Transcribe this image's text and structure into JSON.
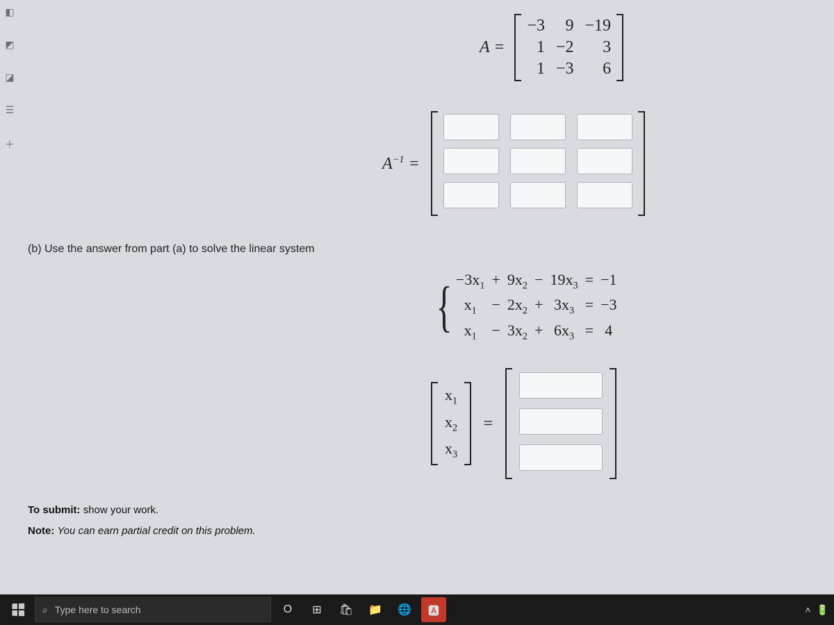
{
  "left_tools": {
    "t1": "◧",
    "t2": "◩",
    "t3": "◪",
    "t4": "☰",
    "t5": "＋"
  },
  "matrixA": {
    "label": "A =",
    "rows": [
      [
        "−3",
        "9",
        "−19"
      ],
      [
        "1",
        "−2",
        "3"
      ],
      [
        "1",
        "−3",
        "6"
      ]
    ]
  },
  "AinvLabel": "A",
  "AinvSup": "−1",
  "AinvEquals": " =",
  "partB": "(b) Use the answer from part (a) to solve the linear system",
  "system": {
    "rows": [
      {
        "c1": "−3x",
        "s1": "1",
        "op1": "+",
        "c2": "9x",
        "s2": "2",
        "op2": "−",
        "c3": "19x",
        "s3": "3",
        "eq": "=",
        "rhs": "−1"
      },
      {
        "c1": "x",
        "s1": "1",
        "op1": "−",
        "c2": "2x",
        "s2": "2",
        "op2": "+",
        "c3": "3x",
        "s3": "3",
        "eq": "=",
        "rhs": "−3"
      },
      {
        "c1": "x",
        "s1": "1",
        "op1": "−",
        "c2": "3x",
        "s2": "2",
        "op2": "+",
        "c3": "6x",
        "s3": "3",
        "eq": "=",
        "rhs": "4"
      }
    ]
  },
  "xvec": {
    "x": "x",
    "subs": [
      "1",
      "2",
      "3"
    ],
    "eq": "="
  },
  "notes": {
    "l1a": "To submit: ",
    "l1b": "show your work.",
    "l2a": "Note: ",
    "l2b": "You can earn partial credit on this problem."
  },
  "taskbar": {
    "search_placeholder": "Type here to search",
    "cortana": "O",
    "taskview": "⊞",
    "store": "🛍",
    "files": "📁",
    "edge": "🌐",
    "app": "🅰",
    "chevron": "˄",
    "battery": "🔋"
  }
}
